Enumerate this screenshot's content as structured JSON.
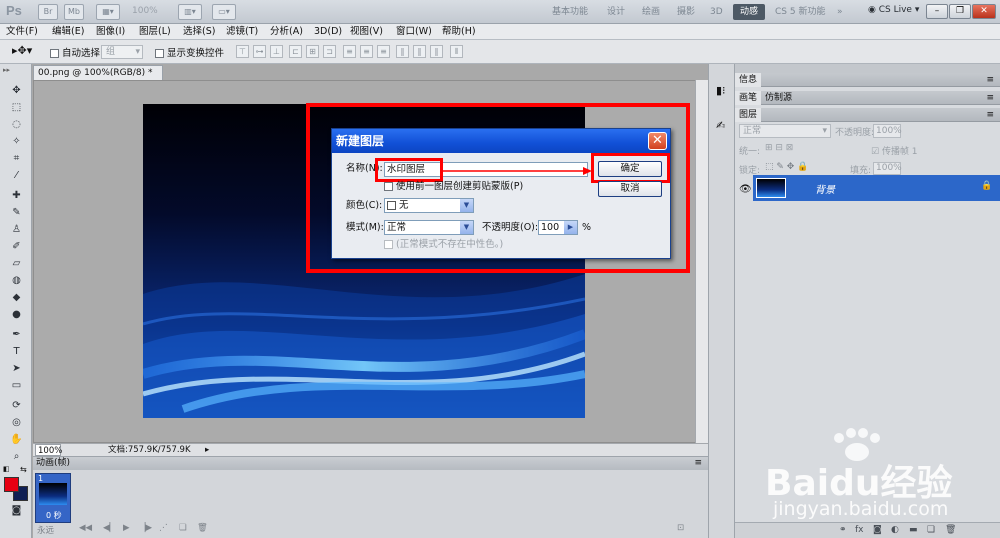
{
  "app": {
    "logo": "Ps",
    "icon_br": "Br",
    "icon_mb": "Mb",
    "zoom": "100%",
    "workspaces": [
      "基本功能",
      "设计",
      "绘画",
      "摄影",
      "3D"
    ],
    "active_workspace": "动感",
    "new_feature": "CS 5 新功能",
    "overflow": "»",
    "cs_live": "CS Live"
  },
  "menu": [
    "文件(F)",
    "编辑(E)",
    "图像(I)",
    "图层(L)",
    "选择(S)",
    "滤镜(T)",
    "分析(A)",
    "3D(D)",
    "视图(V)",
    "窗口(W)",
    "帮助(H)"
  ],
  "options": {
    "auto_select_label": "自动选择:",
    "auto_select_value": "组",
    "show_transform_label": "显示变换控件"
  },
  "document": {
    "tab_title": "00.png @ 100%(RGB/8) *",
    "tab_close": "×",
    "status_zoom": "100%",
    "status_doc": "文档:757.9K/757.9K"
  },
  "animation": {
    "title": "动画(帧)",
    "frame_number": "1",
    "frame_delay": "0 秒",
    "loop_label": "永远"
  },
  "panels": {
    "info_tab": "信息",
    "brush_tab": "画笔",
    "clone_tab": "仿制源",
    "layers_tab": "图层",
    "blend_mode": "正常",
    "opacity_label": "不透明度:",
    "opacity_value": "100%",
    "unify_label": "统一:",
    "propagate_label": "传播帧 1",
    "lock_label": "锁定:",
    "fill_label": "填充:",
    "fill_value": "100%",
    "layer_name": "背景"
  },
  "dialog": {
    "title": "新建图层",
    "close": "✕",
    "name_label": "名称(N):",
    "name_value": "水印图层",
    "clip_label": "使用前一图层创建剪贴蒙版(P)",
    "color_label": "颜色(C):",
    "color_value": "无",
    "mode_label": "模式(M):",
    "mode_value": "正常",
    "opacity_label": "不透明度(O):",
    "opacity_value": "100",
    "opacity_unit": "%",
    "neutral_label": "(正常模式不存在中性色。)",
    "ok_label": "确定",
    "cancel_label": "取消"
  },
  "watermark": {
    "brand": "Baidu经验",
    "url": "jingyan.baidu.com"
  },
  "colors": {
    "highlight_red": "#ff0000",
    "dialog_title_blue": "#1150d6",
    "selected_layer_blue": "#2c67c9",
    "foreground": "#e60012",
    "background": "#0e1e54"
  }
}
